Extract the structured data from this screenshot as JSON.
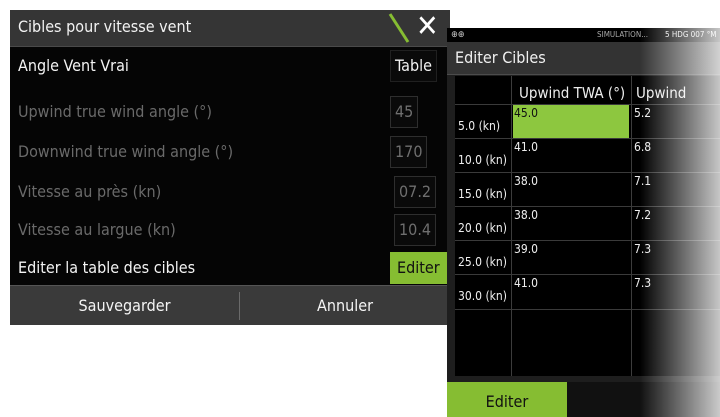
{
  "dialog": {
    "title": "Cibles pour vitesse vent",
    "rows": [
      {
        "label": "Angle Vent Vrai",
        "value": "Table"
      },
      {
        "label": "Upwind true wind angle (°)",
        "value": "45"
      },
      {
        "label": "Downwind true wind angle (°)",
        "value": "170"
      },
      {
        "label": "Vitesse au près (kn)",
        "value": "07.2"
      },
      {
        "label": "Vitesse au largue (kn)",
        "value": "10.4"
      },
      {
        "label": "Editer la table des cibles",
        "value": "Editer"
      }
    ],
    "save_label": "Sauvegarder",
    "cancel_label": "Annuler",
    "accent_color": "#86bd32"
  },
  "panel": {
    "status": {
      "icons": "⊕⊕",
      "simulation": "SIMULATION...",
      "hdg": "5 HDG 007 °M"
    },
    "title": "Editer Cibles",
    "columns": [
      "Upwind TWA (°)",
      "Upwind"
    ],
    "rows": [
      {
        "label": "5.0 (kn)",
        "twa": "45.0",
        "speed": "5.2"
      },
      {
        "label": "10.0 (kn)",
        "twa": "41.0",
        "speed": "6.8"
      },
      {
        "label": "15.0 (kn)",
        "twa": "38.0",
        "speed": "7.1"
      },
      {
        "label": "20.0 (kn)",
        "twa": "38.0",
        "speed": "7.2"
      },
      {
        "label": "25.0 (kn)",
        "twa": "39.0",
        "speed": "7.3"
      },
      {
        "label": "30.0 (kn)",
        "twa": "41.0",
        "speed": "7.3"
      }
    ],
    "edit_label": "Editer"
  }
}
